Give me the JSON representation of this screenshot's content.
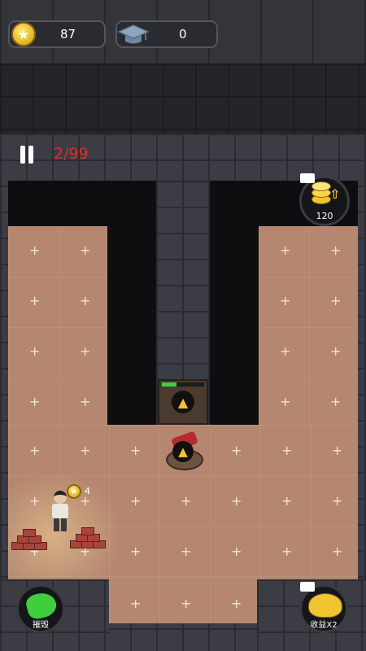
{
  "hud": {
    "coins": "87",
    "scholars": "0",
    "wave": "2/99"
  },
  "rewards": {
    "coin_bonus": "120",
    "worker_coin": "4"
  },
  "buttons": {
    "demolish_label": "摧毁",
    "double_label": "收益X2"
  },
  "colors": {
    "wave_text": "#e02a2a",
    "floor": "#b58770",
    "gold": "#f0c531",
    "green": "#3fcf3d"
  }
}
